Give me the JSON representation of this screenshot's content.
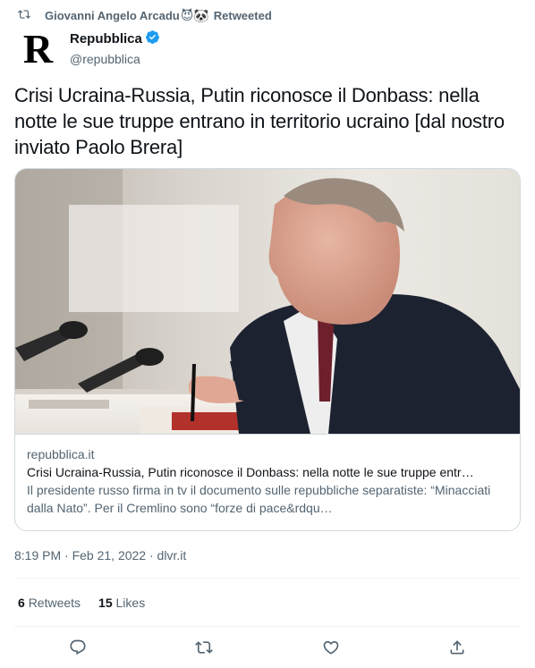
{
  "retweet": {
    "retweeter": "Giovanni Angelo Arcadu",
    "emojis": "😈🐼",
    "label": "Retweeted",
    "icon": "retweet-icon"
  },
  "author": {
    "avatar_letter": "R",
    "display_name": "Repubblica",
    "verified": true,
    "handle": "@repubblica"
  },
  "tweet": {
    "text": "Crisi Ucraina-Russia, Putin riconosce il Donbass: nella notte le sue truppe entrano in territorio ucraino [dal nostro inviato Paolo Brera]"
  },
  "card": {
    "domain": "repubblica.it",
    "title": "Crisi Ucraina-Russia, Putin riconosce il Donbass: nella notte le sue truppe entr…",
    "description": "Il presidente russo firma in tv il documento sulle repubbliche separatiste: “Minacciati dalla Nato”. Per il Cremlino sono “forze di pace&rdqu…"
  },
  "meta": {
    "text": "8:19 PM · Feb 21, 2022 · dlvr.it"
  },
  "stats": {
    "retweets_count": "6",
    "retweets_label": "Retweets",
    "likes_count": "15",
    "likes_label": "Likes"
  },
  "actions": [
    "reply-icon",
    "retweet-icon",
    "like-icon",
    "share-icon"
  ],
  "colors": {
    "text": "#0f1419",
    "secondary": "#536471",
    "border": "#cfd9de",
    "verified": "#1d9bf0"
  }
}
